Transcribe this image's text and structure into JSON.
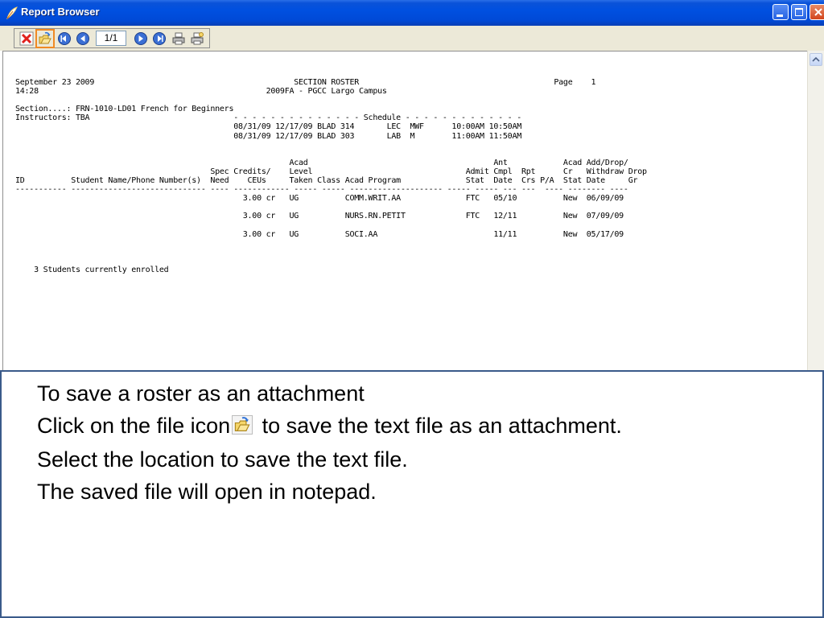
{
  "window": {
    "title": "Report Browser"
  },
  "toolbar": {
    "page_indicator": "1/1"
  },
  "report": {
    "lines": [
      "September 23 2009                                           SECTION ROSTER                                          Page    1",
      "14:28                                                 2009FA - PGCC Largo Campus",
      "",
      "Section....: FRN-1010-LD01 French for Beginners",
      "Instructors: TBA                               - - - - - - - - - - - - - - Schedule - - - - - - - - - - - - -",
      "                                               08/31/09 12/17/09 BLAD 314       LEC  MWF      10:00AM 10:50AM",
      "                                               08/31/09 12/17/09 BLAD 303       LAB  M        11:00AM 11:50AM",
      "",
      "",
      "                                                           Acad                                        Ant            Acad Add/Drop/",
      "                                          Spec Credits/    Level                                 Admit Cmpl  Rpt      Cr   Withdraw Drop",
      "ID          Student Name/Phone Number(s)  Need    CEUs     Taken Class Acad Program              Stat  Date  Crs P/A  Stat Date     Gr",
      "----------- ----------------------------- ---- ------------ ----- ----- -------------------- ----- ----- --- ---  ---- -------- ----",
      "                                                 3.00 cr   UG          COMM.WRIT.AA              FTC   05/10          New  06/09/09",
      "",
      "                                                 3.00 cr   UG          NURS.RN.PETIT             FTC   12/11          New  07/09/09",
      "",
      "                                                 3.00 cr   UG          SOCI.AA                         11/11          New  05/17/09",
      "",
      "",
      "",
      "    3 Students currently enrolled"
    ]
  },
  "instructions": {
    "line1": "To save a roster as an attachment",
    "line2_before": "Click on the file icon",
    "line2_after": " to save the text file as an attachment.",
    "line3": "Select the location to save the text file.",
    "line4": "The saved file will open in notepad."
  },
  "colors": {
    "titlebar": "#0050e0",
    "highlight": "#f08a24",
    "panel_border": "#3a5a8a"
  },
  "icons": [
    "feather-icon",
    "close-report-icon",
    "save-file-icon",
    "first-page-icon",
    "previous-page-icon",
    "next-page-icon",
    "last-page-icon",
    "print-icon",
    "print-setup-icon",
    "scroll-up-icon"
  ]
}
